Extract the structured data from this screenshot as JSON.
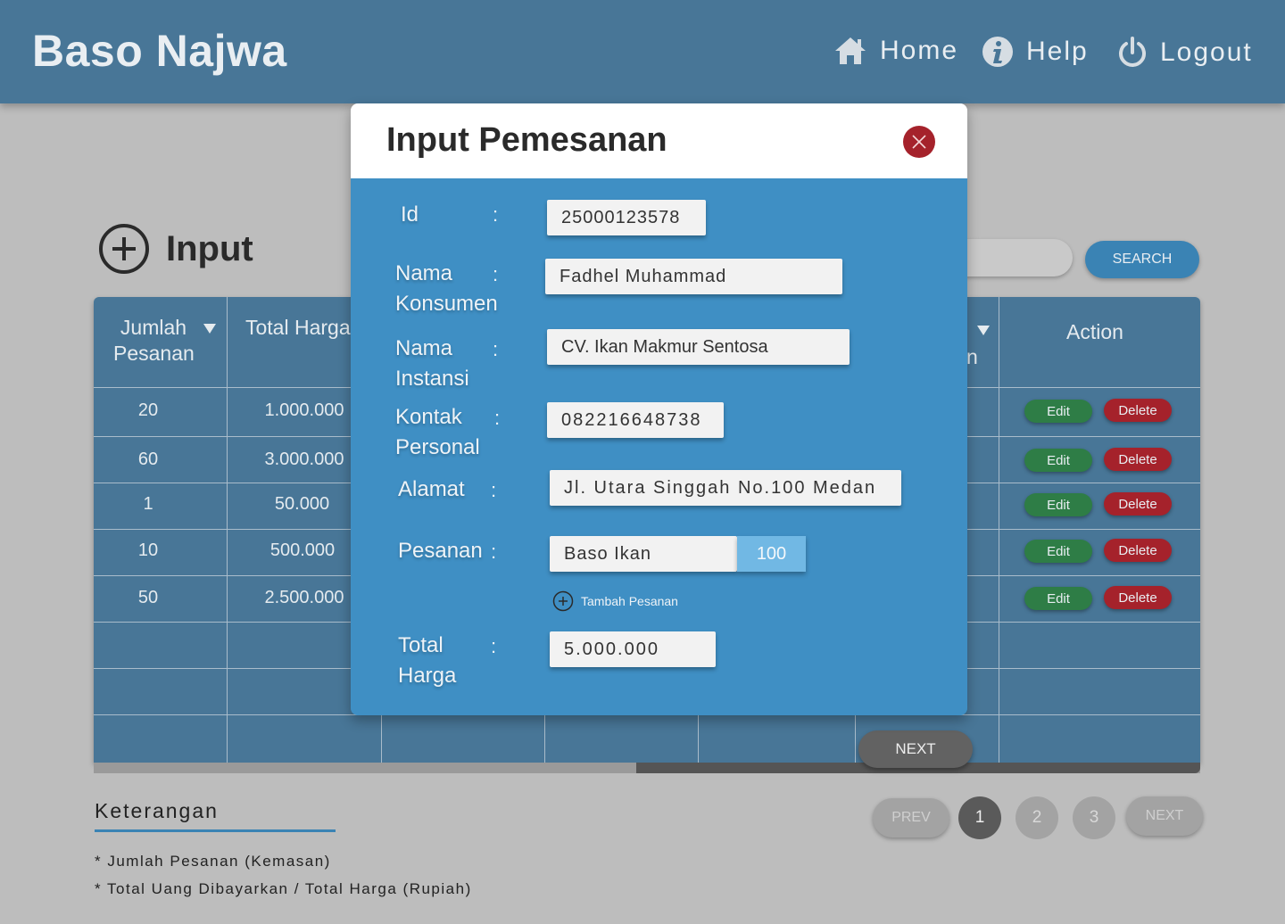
{
  "header": {
    "brand": "Baso Najwa",
    "nav": [
      {
        "label": "Home",
        "icon": "home-icon"
      },
      {
        "label": "Help",
        "icon": "info-icon"
      },
      {
        "label": "Logout",
        "icon": "power-icon"
      }
    ]
  },
  "page": {
    "input_label": "Input",
    "search_button": "SEARCH"
  },
  "table": {
    "headers": {
      "jumlah_l1": "Jumlah",
      "jumlah_l2": "Pesanan",
      "total": "Total Harga",
      "partial_col": "n",
      "action": "Action"
    },
    "rows": [
      {
        "jumlah": "20",
        "total": "1.000.000",
        "edit": "Edit",
        "delete": "Delete"
      },
      {
        "jumlah": "60",
        "total": "3.000.000",
        "edit": "Edit",
        "delete": "Delete"
      },
      {
        "jumlah": "1",
        "total": "50.000",
        "edit": "Edit",
        "delete": "Delete"
      },
      {
        "jumlah": "10",
        "total": "500.000",
        "edit": "Edit",
        "delete": "Delete"
      },
      {
        "jumlah": "50",
        "total": "2.500.000",
        "edit": "Edit",
        "delete": "Delete"
      }
    ],
    "next_button": "NEXT"
  },
  "keterangan": {
    "title": "Keterangan",
    "notes": [
      "* Jumlah Pesanan (Kemasan)",
      "* Total Uang Dibayarkan / Total Harga (Rupiah)"
    ]
  },
  "pagination": {
    "prev": "PREV",
    "pages": [
      "1",
      "2",
      "3"
    ],
    "active": "1",
    "next": "NEXT"
  },
  "modal": {
    "title": "Input Pemesanan",
    "fields": {
      "id_label": "Id",
      "id_value": "25000123578",
      "nama_label_1": "Nama",
      "nama_label_2": "Konsumen",
      "nama_value": "Fadhel Muhammad",
      "instansi_label_1": "Nama",
      "instansi_label_2": "Instansi",
      "instansi_value": "CV. Ikan Makmur Sentosa",
      "kontak_label_1": "Kontak",
      "kontak_label_2": "Personal",
      "kontak_value": "082216648738",
      "alamat_label": "Alamat",
      "alamat_value": "Jl. Utara Singgah No.100 Medan",
      "pesanan_label": "Pesanan",
      "pesanan_value": "Baso Ikan",
      "pesanan_qty": "100",
      "tambah_pesanan": "Tambah Pesanan",
      "total_label_1": "Total",
      "total_label_2": "Harga",
      "total_value": "5.000.000",
      "colon": ":"
    }
  }
}
